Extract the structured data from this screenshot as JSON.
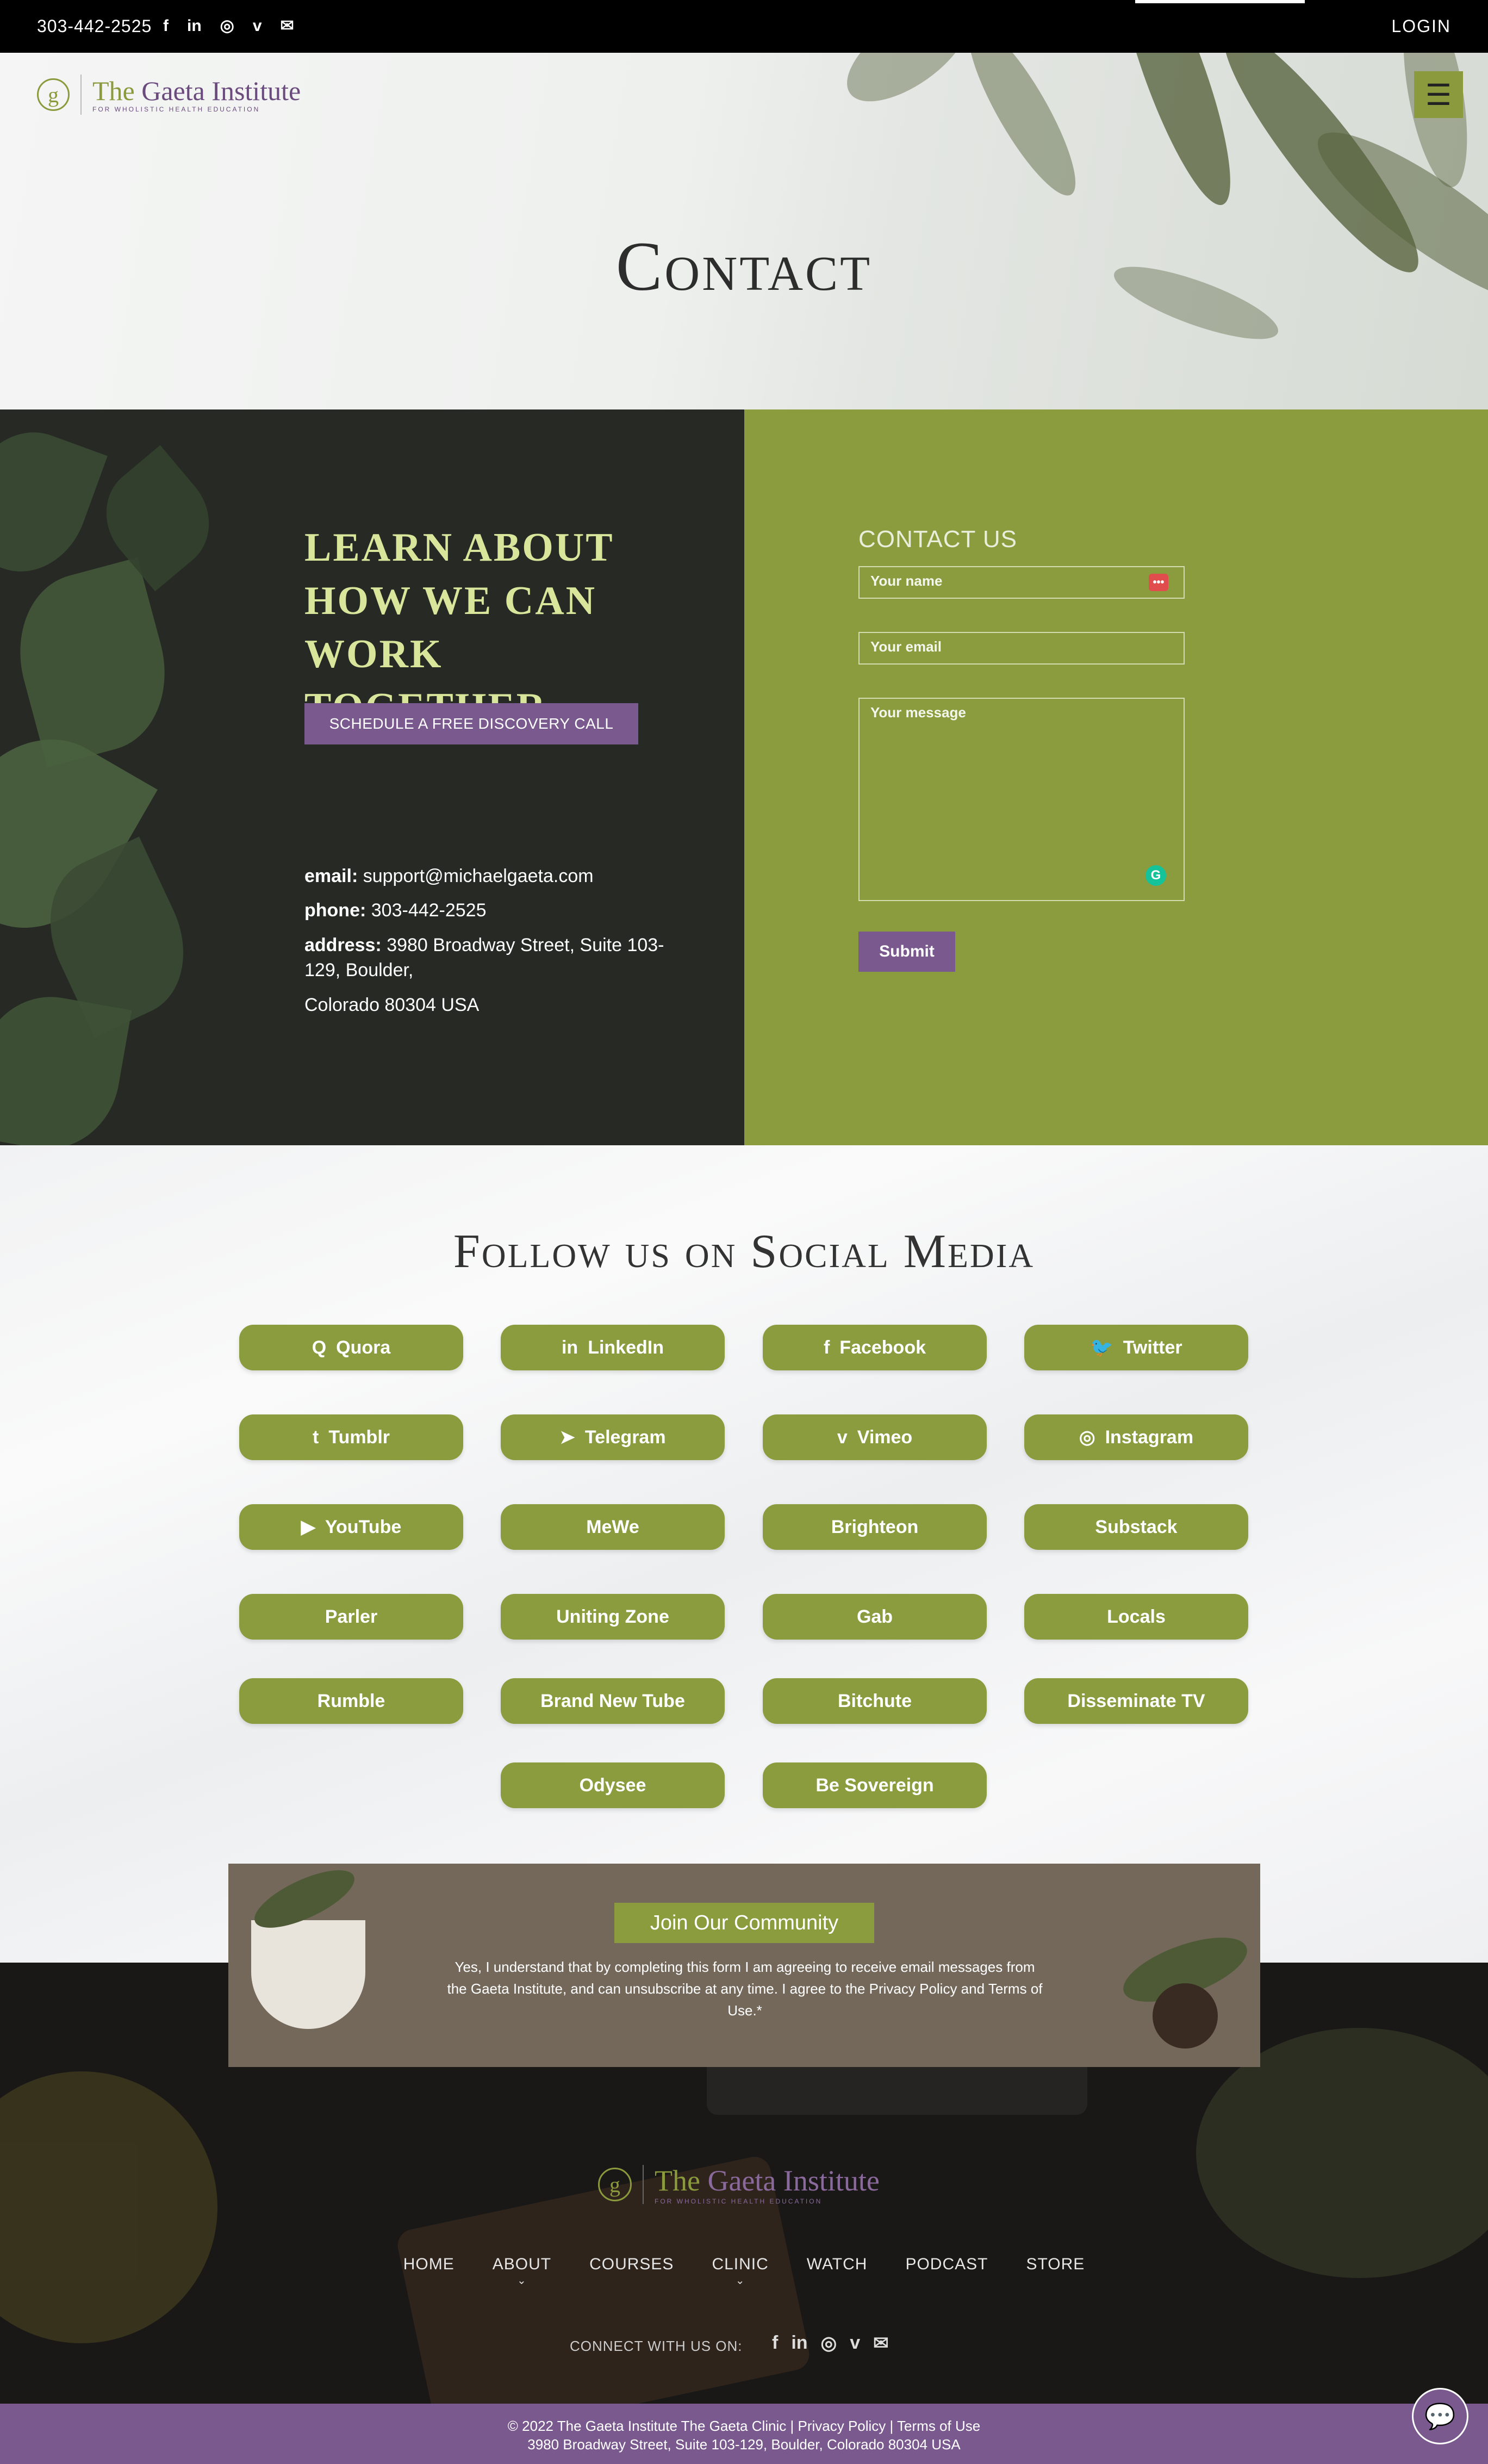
{
  "topbar": {
    "phone": "303-442-2525",
    "social_icons": [
      "facebook-icon",
      "linkedin-icon",
      "instagram-icon",
      "vimeo-icon",
      "mail-icon"
    ],
    "social_glyphs": [
      "f",
      "in",
      "◎",
      "v",
      "✉"
    ],
    "login": "LOGIN"
  },
  "brand": {
    "mark": "g",
    "the": "The ",
    "name": "Gaeta Institute",
    "tagline": "FOR WHOLISTIC HEALTH EDUCATION"
  },
  "menu_icon": "☰",
  "hero": {
    "title": "Contact"
  },
  "promo": {
    "heading": "LEARN ABOUT HOW WE CAN WORK TOGETHER",
    "cta": "SCHEDULE A FREE DISCOVERY CALL"
  },
  "contact_info": {
    "email_label": "email:",
    "email": "support@michaelgaeta.com",
    "phone_label": "phone:",
    "phone": "303-442-2525",
    "address_label": "address:",
    "address_line1": "3980 Broadway Street, Suite 103-129, Boulder,",
    "address_line2": "Colorado 80304 USA"
  },
  "form": {
    "title": "CONTACT US",
    "name_placeholder": "Your name",
    "email_placeholder": "Your email",
    "message_placeholder": "Your message",
    "submit": "Submit",
    "pw_badge": "•••",
    "grammarly_badge": "G"
  },
  "social": {
    "title": "Follow us on Social Media",
    "buttons": [
      {
        "label": "Quora",
        "icon": "Q"
      },
      {
        "label": "LinkedIn",
        "icon": "in"
      },
      {
        "label": "Facebook",
        "icon": "f"
      },
      {
        "label": "Twitter",
        "icon": "🐦"
      },
      {
        "label": "Tumblr",
        "icon": "t"
      },
      {
        "label": "Telegram",
        "icon": "➤"
      },
      {
        "label": "Vimeo",
        "icon": "v"
      },
      {
        "label": "Instagram",
        "icon": "◎"
      },
      {
        "label": "YouTube",
        "icon": "▶"
      },
      {
        "label": "MeWe",
        "icon": ""
      },
      {
        "label": "Brighteon",
        "icon": ""
      },
      {
        "label": "Substack",
        "icon": ""
      },
      {
        "label": "Parler",
        "icon": ""
      },
      {
        "label": "Uniting Zone",
        "icon": ""
      },
      {
        "label": "Gab",
        "icon": ""
      },
      {
        "label": "Locals",
        "icon": ""
      },
      {
        "label": "Rumble",
        "icon": ""
      },
      {
        "label": "Brand New Tube",
        "icon": ""
      },
      {
        "label": "Bitchute",
        "icon": ""
      },
      {
        "label": "Disseminate TV",
        "icon": ""
      },
      {
        "label": "Odysee",
        "icon": ""
      },
      {
        "label": "Be Sovereign",
        "icon": ""
      }
    ]
  },
  "community": {
    "button": "Join Our Community",
    "consent": "Yes, I understand that by completing this form I am agreeing to receive email messages from the Gaeta Institute, and can unsubscribe at any time. I agree to the Privacy Policy and Terms of Use.*"
  },
  "footer": {
    "nav": [
      {
        "label": "HOME",
        "has_dropdown": false
      },
      {
        "label": "ABOUT",
        "has_dropdown": true
      },
      {
        "label": "COURSES",
        "has_dropdown": false
      },
      {
        "label": "CLINIC",
        "has_dropdown": true
      },
      {
        "label": "WATCH",
        "has_dropdown": false
      },
      {
        "label": "PODCAST",
        "has_dropdown": false
      },
      {
        "label": "STORE",
        "has_dropdown": false
      }
    ],
    "dropdown_glyph": "⌄",
    "connect": "CONNECT WITH US ON:",
    "social_icons": [
      "facebook-icon",
      "linkedin-icon",
      "instagram-icon",
      "vimeo-icon",
      "mail-icon"
    ],
    "social_glyphs": [
      "f",
      "in",
      "◎",
      "v",
      "✉"
    ],
    "copyright_line1": "© 2022 The Gaeta Institute The Gaeta Clinic | Privacy Policy | Terms of Use",
    "copyright_line2": "3980 Broadway Street, Suite 103-129, Boulder, Colorado 80304 USA"
  },
  "chat_icon": "💬",
  "colors": {
    "olive": "#8a9c3e",
    "purple": "#7a5a8e",
    "heading_lime": "#d8e59b",
    "dark_green": "#262924"
  }
}
